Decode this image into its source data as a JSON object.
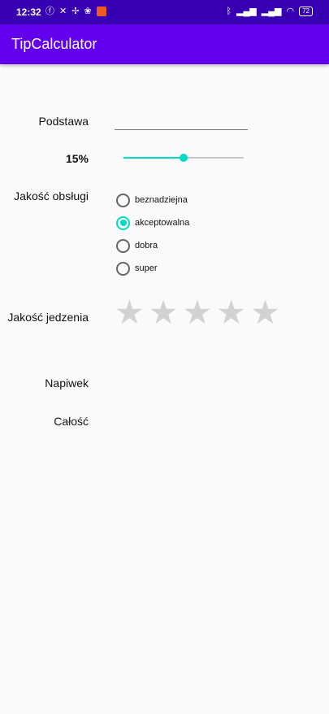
{
  "status_bar": {
    "time": "12:32",
    "battery": "72",
    "left_icons": [
      "facebook-icon",
      "x-icon",
      "pinwheel-icon",
      "app-icon",
      "orange-app-icon"
    ],
    "right_icons": [
      "bluetooth-icon",
      "signal-icon",
      "signal-icon",
      "wifi-icon",
      "battery-icon"
    ]
  },
  "app_bar": {
    "title": "TipCalculator",
    "color": "#6200ee",
    "status_color": "#3700b3"
  },
  "form": {
    "base": {
      "label": "Podstawa",
      "value": ""
    },
    "percent": {
      "label": "15%",
      "value": 15,
      "fraction": 0.5
    },
    "service": {
      "label": "Jakość obsługi",
      "options": [
        "beznadziejna",
        "akceptowalna",
        "dobra",
        "super"
      ],
      "selected_index": 1
    },
    "food": {
      "label": "Jakość jedzenia",
      "stars_total": 5,
      "stars_filled": 0
    },
    "tip": {
      "label": "Napiwek"
    },
    "total": {
      "label": "Całość"
    }
  },
  "accent_color": "#03dac5"
}
